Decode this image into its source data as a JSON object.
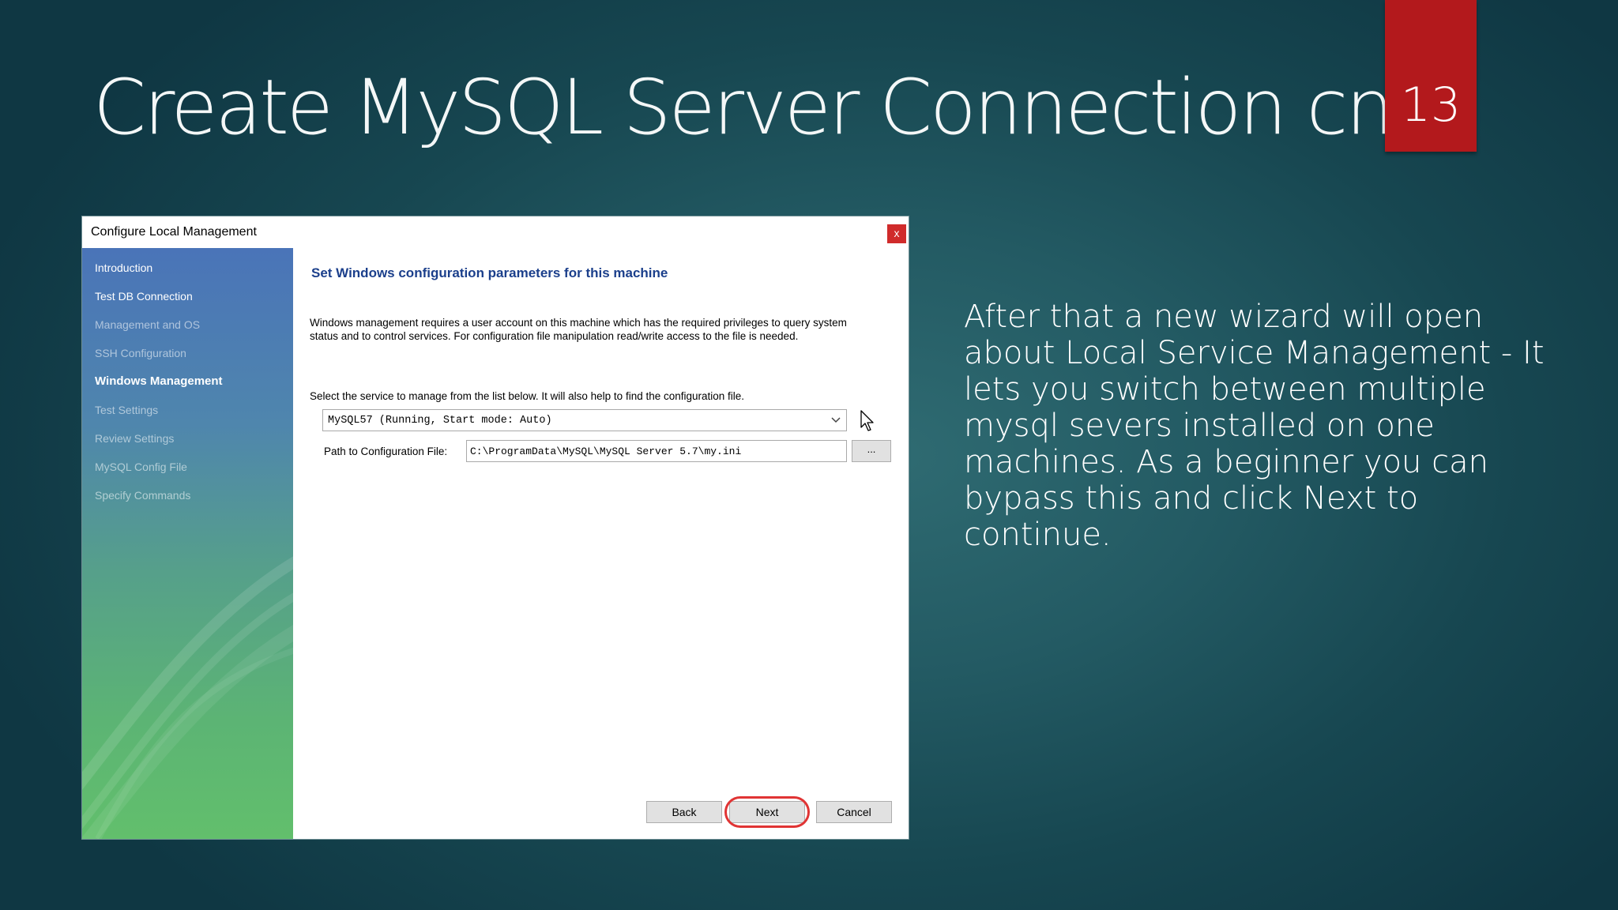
{
  "slide": {
    "title": "Create MySQL Server Connection cnt..",
    "page_number": "13",
    "body_text": "After that a new wizard will open about Local Service Management - It lets you switch between multiple mysql severs installed on one machines. As a beginner you can bypass this and click Next  to continue.",
    "colors": {
      "badge": "#b3191c",
      "background": "#235a63"
    }
  },
  "dialog": {
    "title": "Configure Local Management",
    "close_label": "x",
    "sidebar": {
      "items": [
        {
          "label": "Introduction",
          "state": "done"
        },
        {
          "label": "Test DB Connection",
          "state": "done"
        },
        {
          "label": "Management and OS",
          "state": "pending"
        },
        {
          "label": "SSH Configuration",
          "state": "pending"
        },
        {
          "label": "Windows Management",
          "state": "active"
        },
        {
          "label": "Test Settings",
          "state": "pending"
        },
        {
          "label": "Review Settings",
          "state": "pending"
        },
        {
          "label": "MySQL Config File",
          "state": "pending"
        },
        {
          "label": "Specify Commands",
          "state": "pending"
        }
      ]
    },
    "content": {
      "heading": "Set Windows configuration parameters for this machine",
      "description": "Windows management requires a user account on this machine which has the required privileges to query system status and to control services. For configuration file manipulation read/write access to the file is needed.",
      "select_label": "Select the service to manage from the list below. It will also help to find the configuration file.",
      "service_value": "MySQL57 (Running, Start mode: Auto)",
      "path_label": "Path to Configuration File:",
      "path_value": "C:\\ProgramData\\MySQL\\MySQL Server 5.7\\my.ini",
      "browse_label": "..."
    },
    "buttons": {
      "back": "Back",
      "next": "Next",
      "cancel": "Cancel"
    },
    "highlight_color": "#e03434"
  }
}
